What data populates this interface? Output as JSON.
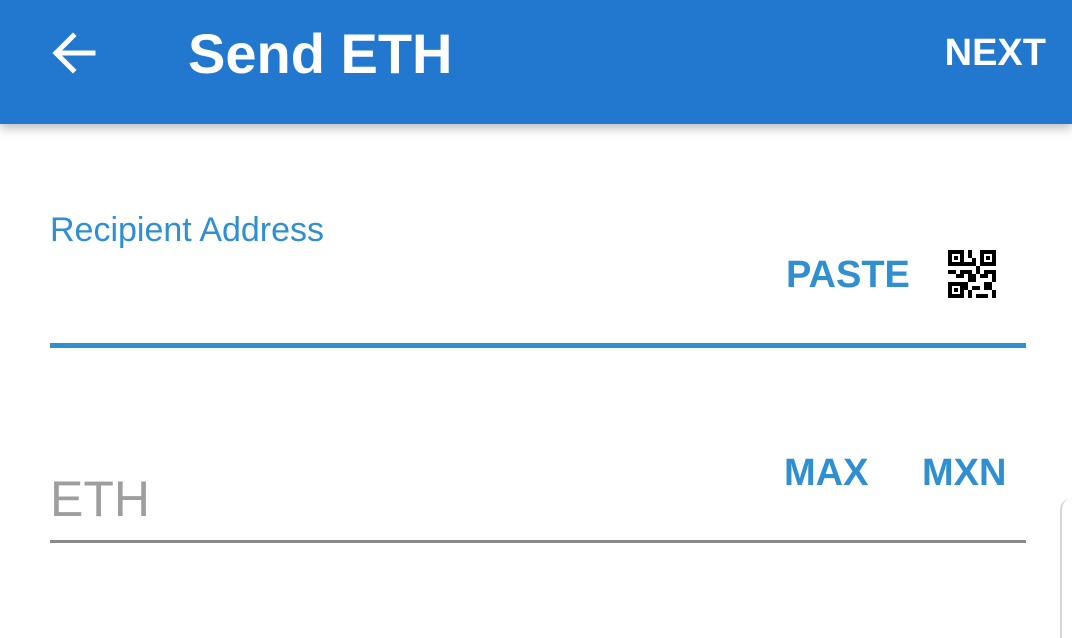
{
  "app_bar": {
    "back_icon": "arrow-left-icon",
    "title": "Send ETH",
    "next_label": "NEXT",
    "background_color": "#2277cf"
  },
  "recipient": {
    "label": "Recipient Address",
    "value": "",
    "paste_label": "PASTE",
    "qr_icon": "qr-code-icon",
    "accent_color": "#2f8fd0"
  },
  "amount": {
    "placeholder": "ETH",
    "value": "",
    "max_label": "MAX",
    "currency_label": "MXN"
  }
}
